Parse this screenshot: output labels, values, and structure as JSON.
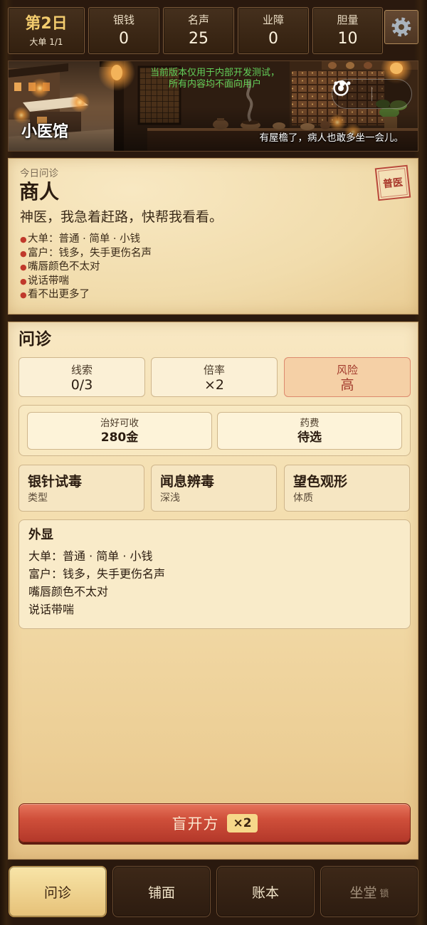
{
  "stats": {
    "day": "第2日",
    "order": "大单 1/1",
    "items": [
      {
        "label": "银钱",
        "value": "0"
      },
      {
        "label": "名声",
        "value": "25"
      },
      {
        "label": "业障",
        "value": "0"
      },
      {
        "label": "胆量",
        "value": "10"
      }
    ],
    "settings_icon": "gear-icon"
  },
  "banner": {
    "notice_lines": [
      "当前版本仅用于内部开发测试，",
      "所有内容均不面向用户"
    ],
    "shop_name": "小医馆",
    "caption": "有屋檐了，病人也敢多坐一会儿。",
    "capsule": {
      "more_icon": "more-dots-icon",
      "close_icon": "target-circle-icon"
    }
  },
  "patient": {
    "subtitle": "今日问诊",
    "name": "商人",
    "quote": "神医，我急着赶路，快帮我看看。",
    "stamp": "普医",
    "traits": [
      "大单：普通 · 简单 · 小钱",
      "富户：钱多，失手更伤名声",
      "嘴唇颜色不太对",
      "说话带喘",
      "看不出更多了"
    ]
  },
  "consult": {
    "title": "问诊",
    "metrics": [
      {
        "label": "线索",
        "value": "0/3"
      },
      {
        "label": "倍率",
        "value": "×2"
      },
      {
        "label": "风险",
        "value": "高"
      }
    ],
    "payment": [
      {
        "label": "治好可收",
        "value": "280金"
      },
      {
        "label": "药费",
        "value": "待选"
      }
    ],
    "actions": [
      {
        "title": "银针试毒",
        "subtitle": "类型"
      },
      {
        "title": "闻息辨毒",
        "subtitle": "深浅"
      },
      {
        "title": "望色观形",
        "subtitle": "体质"
      }
    ],
    "appearance": {
      "title": "外显",
      "lines": [
        "大单：普通 · 简单 · 小钱",
        "富户：钱多，失手更伤名声",
        "嘴唇颜色不太对",
        "说话带喘"
      ]
    },
    "prescribe_button": {
      "label": "盲开方",
      "badge": "×2"
    }
  },
  "tabs": [
    {
      "label": "问诊",
      "active": true
    },
    {
      "label": "铺面"
    },
    {
      "label": "账本"
    },
    {
      "label": "坐堂",
      "lock_label": "锁",
      "locked": true
    }
  ],
  "colors": {
    "day_gold": "#f3cc6e",
    "notice_green": "#63d05a",
    "stamp_red": "#b8473a",
    "risk_text": "#a23a2c",
    "risk_bg": "#f5d0a6",
    "button_red": "#cf4f3a",
    "badge_gold": "#f6d88a",
    "active_tab": "#f2d68e"
  }
}
